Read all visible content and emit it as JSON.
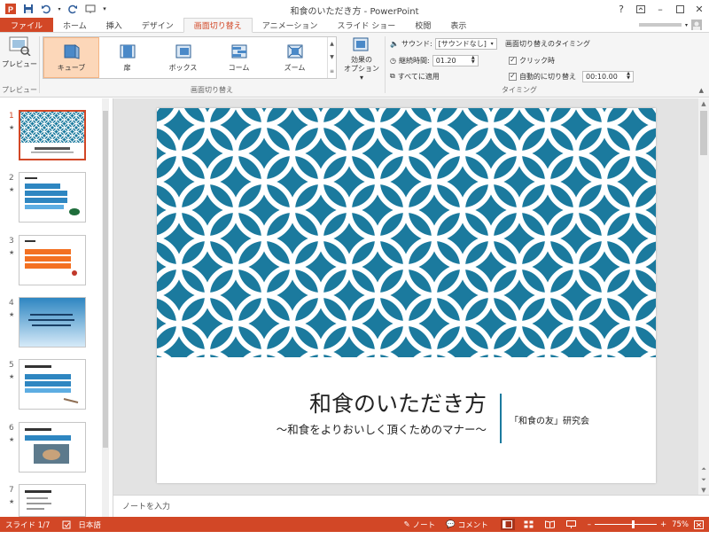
{
  "app": {
    "title": "和食のいただき方 - PowerPoint"
  },
  "tabs": [
    {
      "label": "ファイル",
      "key": "file"
    },
    {
      "label": "ホーム",
      "key": "home"
    },
    {
      "label": "挿入",
      "key": "insert"
    },
    {
      "label": "デザイン",
      "key": "design"
    },
    {
      "label": "画面切り替え",
      "key": "transitions"
    },
    {
      "label": "アニメーション",
      "key": "animations"
    },
    {
      "label": "スライド ショー",
      "key": "slideshow"
    },
    {
      "label": "校閲",
      "key": "review"
    },
    {
      "label": "表示",
      "key": "view"
    }
  ],
  "ribbon": {
    "preview": {
      "button": "プレビュー",
      "group": "プレビュー"
    },
    "transitions": {
      "group": "画面切り替え",
      "items": [
        {
          "label": "キューブ",
          "selected": true
        },
        {
          "label": "扉",
          "selected": false
        },
        {
          "label": "ボックス",
          "selected": false
        },
        {
          "label": "コーム",
          "selected": false
        },
        {
          "label": "ズーム",
          "selected": false
        }
      ],
      "effect_options_line1": "効果の",
      "effect_options_line2": "オプション"
    },
    "timing": {
      "group": "タイミング",
      "sound_label": "サウンド:",
      "sound_value": "[サウンドなし]",
      "duration_label": "継続時間:",
      "duration_value": "01.20",
      "apply_all": "すべてに適用",
      "advance_header": "画面切り替えのタイミング",
      "on_click": "クリック時",
      "after_label": "自動的に切り替え",
      "after_value": "00:10.00"
    }
  },
  "slides": [
    {
      "number": "1",
      "active": true
    },
    {
      "number": "2",
      "active": false
    },
    {
      "number": "3",
      "active": false
    },
    {
      "number": "4",
      "active": false
    },
    {
      "number": "5",
      "active": false
    },
    {
      "number": "6",
      "active": false
    },
    {
      "number": "7",
      "active": false
    }
  ],
  "slide": {
    "title": "和食のいただき方",
    "subtitle": "～和食をよりおいしく頂くためのマナー～",
    "org": "「和食の友」研究会",
    "pattern_color": "#1b7a9e"
  },
  "notes": {
    "placeholder": "ノートを入力"
  },
  "status": {
    "slide_info": "スライド 1/7",
    "language": "日本語",
    "notes_btn": "ノート",
    "comments_btn": "コメント",
    "zoom": "75%"
  },
  "colors": {
    "accent": "#d24726",
    "pattern": "#1b7a9e"
  }
}
